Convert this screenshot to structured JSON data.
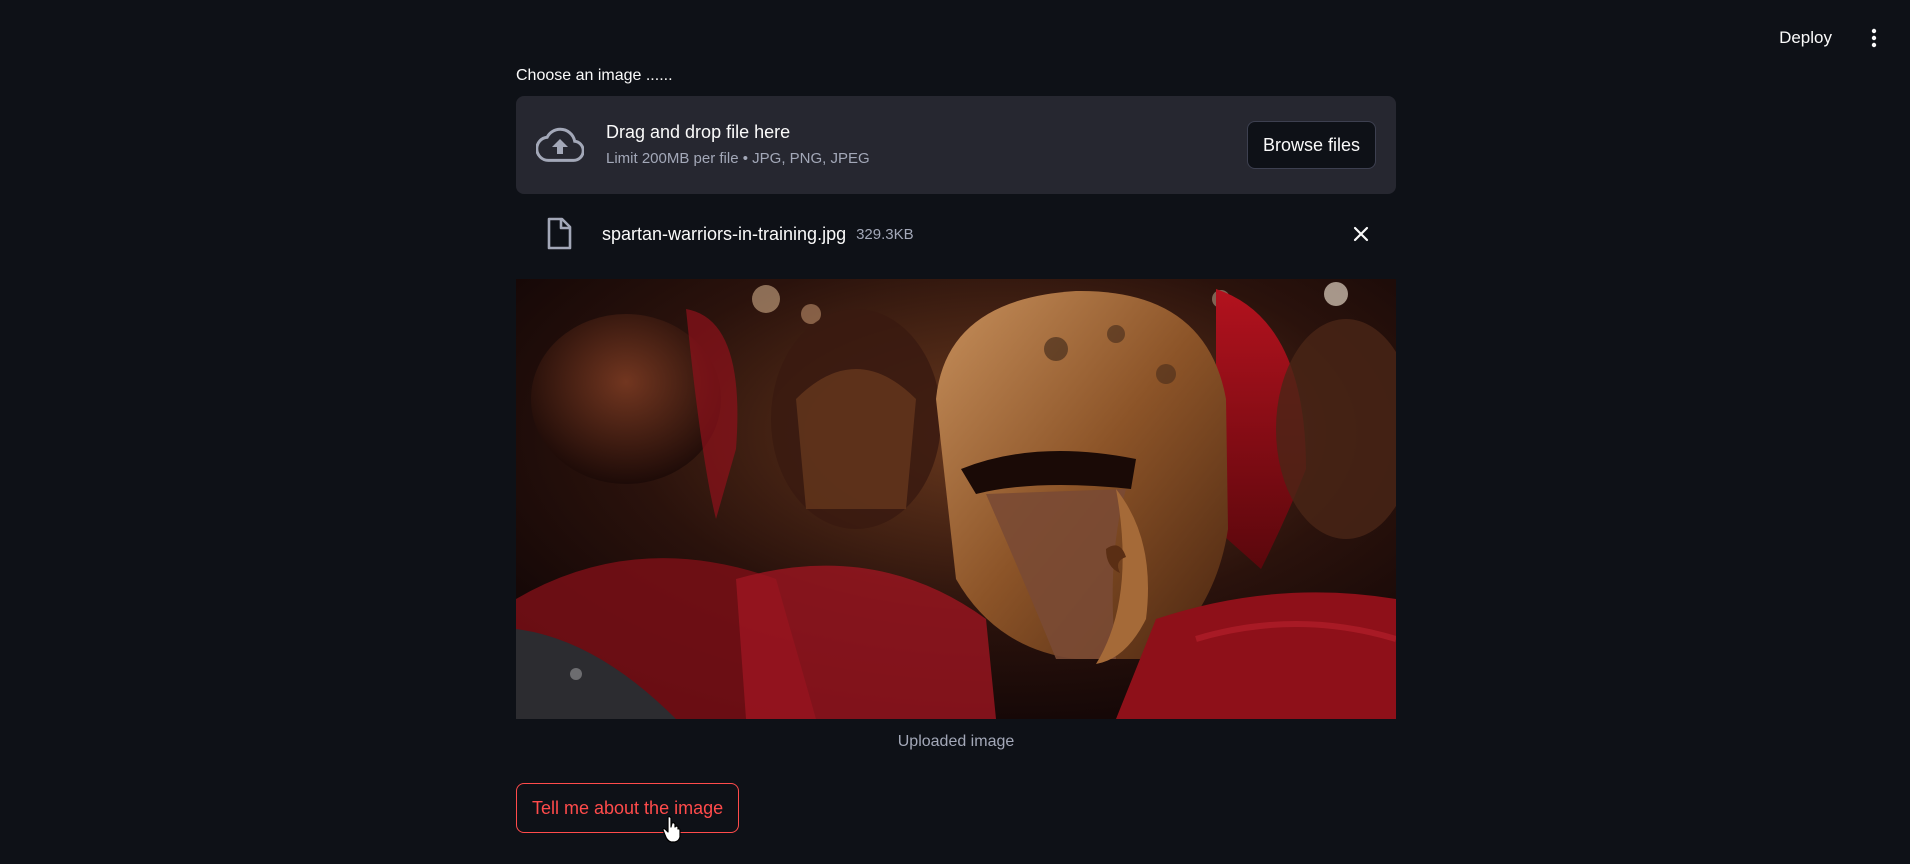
{
  "header": {
    "deploy_label": "Deploy",
    "menu_icon": "kebab-menu-icon"
  },
  "uploader": {
    "label": "Choose an image ......",
    "dropzone_title": "Drag and drop file here",
    "dropzone_limit": "Limit 200MB per file • JPG, PNG, JPEG",
    "browse_label": "Browse files",
    "upload_icon": "cloud-upload-icon"
  },
  "file": {
    "name": "spartan-warriors-in-training.jpg",
    "size": "329.3KB",
    "icon": "file-icon",
    "remove_icon": "close-icon"
  },
  "image": {
    "caption": "Uploaded image"
  },
  "actions": {
    "tell_label": "Tell me about the image"
  },
  "colors": {
    "background": "#0e1117",
    "surface": "#262730",
    "accent": "#ff4b4b",
    "muted_text": "#a3a8b8"
  }
}
